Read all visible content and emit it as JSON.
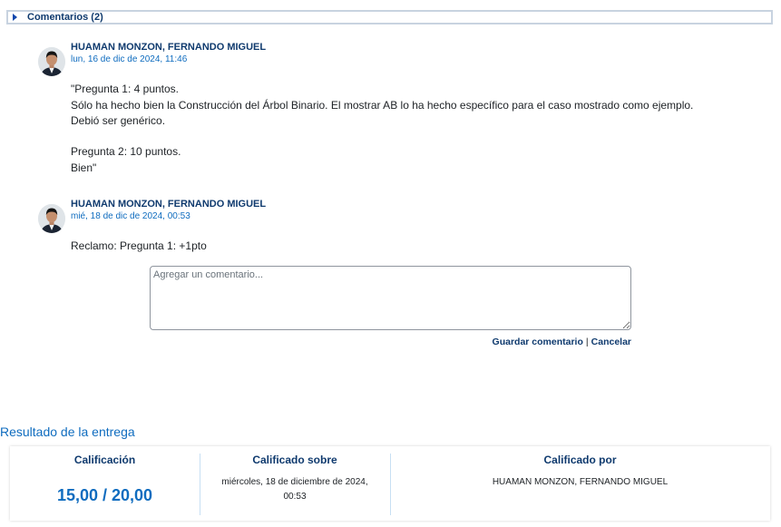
{
  "comments_section": {
    "toggle_label": "Comentarios (2)"
  },
  "comments": [
    {
      "author": "HUAMAN MONZON, FERNANDO MIGUEL",
      "date": "lun, 16 de dic de 2024, 11:46",
      "lines": [
        "\"Pregunta 1: 4 puntos.",
        "Sólo ha hecho bien la Construcción del Árbol Binario. El mostrar AB lo ha hecho específico para el caso mostrado como ejemplo.",
        "Debió ser genérico.",
        "",
        "Pregunta 2: 10 puntos.",
        "Bien\""
      ]
    },
    {
      "author": "HUAMAN MONZON, FERNANDO MIGUEL",
      "date": "mié, 18 de dic de 2024, 00:53",
      "lines": [
        "Reclamo: Pregunta 1: +1pto"
      ]
    }
  ],
  "comment_form": {
    "placeholder": "Agregar un comentario...",
    "value": "",
    "save_label": "Guardar comentario",
    "separator": "|",
    "cancel_label": "Cancelar"
  },
  "result": {
    "section_title": "Resultado de la entrega",
    "grade_label": "Calificación",
    "grade_value": "15,00 / 20,00",
    "graded_on_label": "Calificado sobre",
    "graded_on_line1": "miércoles, 18 de diciembre de 2024,",
    "graded_on_line2": "00:53",
    "graded_by_label": "Calificado por",
    "graded_by_value": "HUAMAN MONZON, FERNANDO MIGUEL"
  },
  "colors": {
    "link_dark": "#0f3a6e",
    "link": "#0f6cbf",
    "text": "#1d2125"
  },
  "icons": {
    "toggle": "caret-right-icon",
    "avatar": "user-avatar-photo"
  }
}
